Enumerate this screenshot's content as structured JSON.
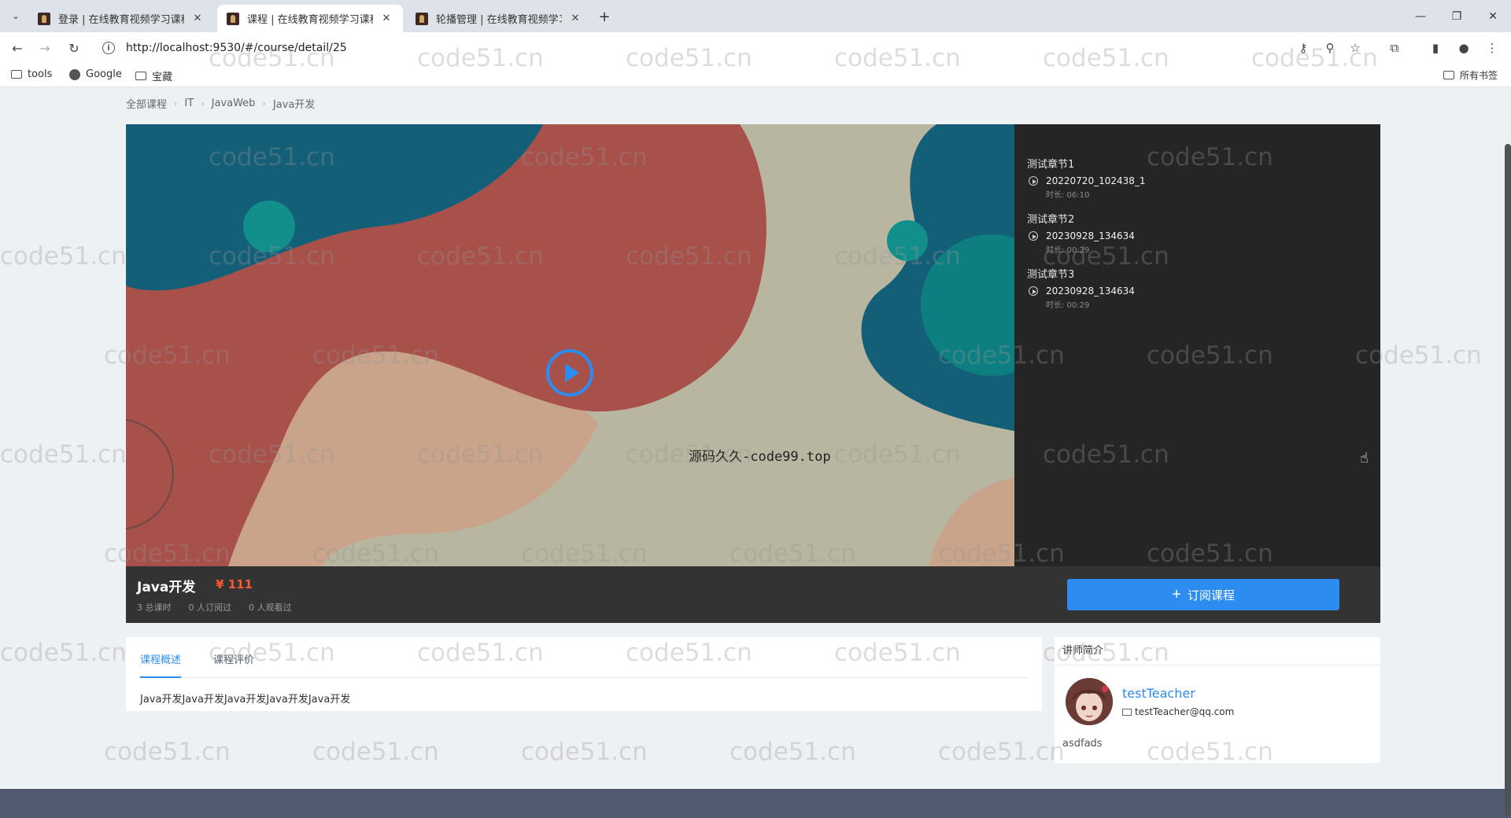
{
  "browser": {
    "tabs": [
      {
        "title": "登录 | 在线教育视频学习课程系统",
        "active": false
      },
      {
        "title": "课程 | 在线教育视频学习课程系统",
        "active": true
      },
      {
        "title": "轮播管理 | 在线教育视频学习课程系统",
        "active": false
      }
    ],
    "url": "http://localhost:9530/#/course/detail/25",
    "bookmarks": [
      "tools",
      "Google",
      "宝藏"
    ],
    "bookmarks_right": "所有书签"
  },
  "breadcrumb": [
    "全部课程",
    "IT",
    "JavaWeb",
    "Java开发"
  ],
  "video": {
    "caption": "源码久久-code99.top"
  },
  "chapters": [
    {
      "title": "测试章节1",
      "lesson": "20220720_102438_1",
      "duration": "时长: 06:10"
    },
    {
      "title": "测试章节2",
      "lesson": "20230928_134634",
      "duration": "时长: 00:29"
    },
    {
      "title": "测试章节3",
      "lesson": "20230928_134634",
      "duration": "时长: 00:29"
    }
  ],
  "course": {
    "name": "Java开发",
    "price": "¥ 111",
    "stats": [
      "3 总课时",
      "0 人订阅过",
      "0 人观看过"
    ],
    "subscribe_label": "订阅课程"
  },
  "tabs": [
    "课程概述",
    "课程评价"
  ],
  "description": "Java开发Java开发Java开发Java开发Java开发",
  "teacher": {
    "heading": "讲师简介",
    "name": "testTeacher",
    "email": "testTeacher@qq.com",
    "bio": "asdfads"
  },
  "watermark": "code51.cn",
  "colors": {
    "accent": "#2d8cf0",
    "price": "#ff5a32",
    "footer": "#515a6e"
  }
}
